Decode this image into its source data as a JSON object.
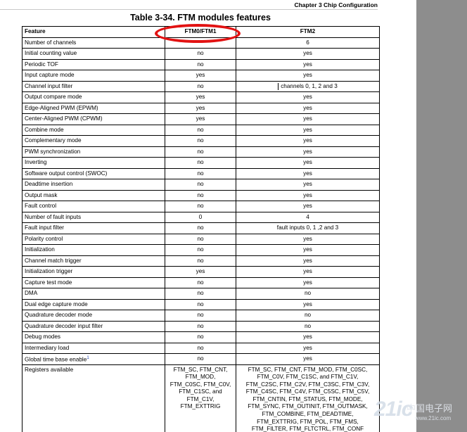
{
  "header": {
    "chapter": "Chapter 3 Chip Configuration"
  },
  "table": {
    "title": "Table 3-34.  FTM modules features",
    "columns": [
      "Feature",
      "FTM0/FTM1",
      "FTM2"
    ],
    "rows": [
      [
        "Number of channels",
        "",
        "6"
      ],
      [
        "Initial counting value",
        "no",
        "yes"
      ],
      [
        "Periodic TOF",
        "no",
        "yes"
      ],
      [
        "Input capture mode",
        "yes",
        "yes"
      ],
      [
        "Channel input filter",
        "no",
        "channels 0, 1, 2 and 3"
      ],
      [
        "Output compare mode",
        "yes",
        "yes"
      ],
      [
        "Edge-Aligned PWM (EPWM)",
        "yes",
        "yes"
      ],
      [
        "Center-Aligned PWM (CPWM)",
        "yes",
        "yes"
      ],
      [
        "Combine mode",
        "no",
        "yes"
      ],
      [
        "Complementary mode",
        "no",
        "yes"
      ],
      [
        "PWM synchronization",
        "no",
        "yes"
      ],
      [
        "Inverting",
        "no",
        "yes"
      ],
      [
        "Software output control (SWOC)",
        "no",
        "yes"
      ],
      [
        "Deadtime insertion",
        "no",
        "yes"
      ],
      [
        "Output mask",
        "no",
        "yes"
      ],
      [
        "Fault control",
        "no",
        "yes"
      ],
      [
        "Number of fault inputs",
        "0",
        "4"
      ],
      [
        "Fault input filter",
        "no",
        "fault inputs 0, 1 ,2 and 3"
      ],
      [
        "Polarity control",
        "no",
        "yes"
      ],
      [
        "Initialization",
        "no",
        "yes"
      ],
      [
        "Channel match trigger",
        "no",
        "yes"
      ],
      [
        "Initialization trigger",
        "yes",
        "yes"
      ],
      [
        "Capture test mode",
        "no",
        "yes"
      ],
      [
        "DMA",
        "no",
        "no"
      ],
      [
        "Dual edge capture mode",
        "no",
        "yes"
      ],
      [
        "Quadrature decoder mode",
        "no",
        "no"
      ],
      [
        "Quadrature decoder input filter",
        "no",
        "no"
      ],
      [
        "Debug modes",
        "no",
        "yes"
      ],
      [
        "Intermediary load",
        "no",
        "yes"
      ],
      [
        "Global time base enable",
        "no",
        "yes"
      ]
    ],
    "footnote_marker": "1",
    "registers_row": {
      "feature": "Registers available",
      "ftm01": [
        "FTM_SC, FTM_CNT,",
        "FTM_MOD,",
        "FTM_C0SC, FTM_C0V,",
        "FTM_C1SC, and",
        "FTM_C1V,",
        "FTM_EXTTRIG"
      ],
      "ftm2": [
        "FTM_SC, FTM_CNT, FTM_MOD, FTM_C0SC,",
        "FTM_C0V, FTM_C1SC, and FTM_C1V,",
        "FTM_C2SC, FTM_C2V, FTM_C3SC, FTM_C3V,",
        "FTM_C4SC, FTM_C4V, FTM_C5SC, FTM_C5V,",
        "FTM_CNTIN, FTM_STATUS, FTM_MODE,",
        "FTM_SYNC, FTM_OUTINIT, FTM_OUTMASK,",
        "FTM_COMBINE, FTM_DEADTIME,",
        "FTM_EXTTRIG, FTM_POL, FTM_FMS,",
        "FTM_FILTER, FTM_FLTCTRL, FTM_CONF"
      ]
    }
  },
  "annotation": {
    "color": "#e21212"
  },
  "watermark": {
    "logo": "21ic",
    "cn": "中国电子网",
    "url": "www.21ic.com"
  }
}
